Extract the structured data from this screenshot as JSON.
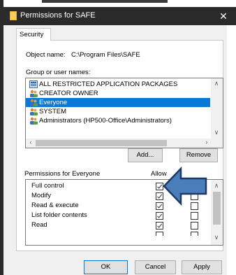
{
  "window": {
    "title": "Permissions for SAFE",
    "close_glyph": "✕"
  },
  "tabs": [
    {
      "label": "Security"
    }
  ],
  "object_name": {
    "label": "Object name:",
    "value": "C:\\Program Files\\SAFE"
  },
  "group_section": {
    "label": "Group or user names:",
    "items": [
      {
        "label": "ALL RESTRICTED APPLICATION PACKAGES",
        "icon": "package-group-icon",
        "selected": false
      },
      {
        "label": "CREATOR OWNER",
        "icon": "user-group-icon",
        "selected": false
      },
      {
        "label": "Everyone",
        "icon": "user-group-icon",
        "selected": true
      },
      {
        "label": "SYSTEM",
        "icon": "user-group-icon",
        "selected": false
      },
      {
        "label": "Administrators (HP500-Office\\Administrators)",
        "icon": "user-group-icon",
        "selected": false
      }
    ]
  },
  "buttons": {
    "add": "Add...",
    "remove": "Remove",
    "ok": "OK",
    "cancel": "Cancel",
    "apply": "Apply"
  },
  "permissions": {
    "header": "Permissions for Everyone",
    "allow_label": "Allow",
    "rows": [
      {
        "name": "Full control",
        "allow": true,
        "deny": false
      },
      {
        "name": "Modify",
        "allow": true,
        "deny": false
      },
      {
        "name": "Read & execute",
        "allow": true,
        "deny": false
      },
      {
        "name": "List folder contents",
        "allow": true,
        "deny": false
      },
      {
        "name": "Read",
        "allow": true,
        "deny": false
      }
    ]
  },
  "colors": {
    "titlebar": "#2b2b2b",
    "selection": "#0a78d7",
    "callout_arrow": "#4a7ebb",
    "callout_outline": "#1f3864"
  },
  "annotation": {
    "icon": "arrow-callout-icon"
  }
}
